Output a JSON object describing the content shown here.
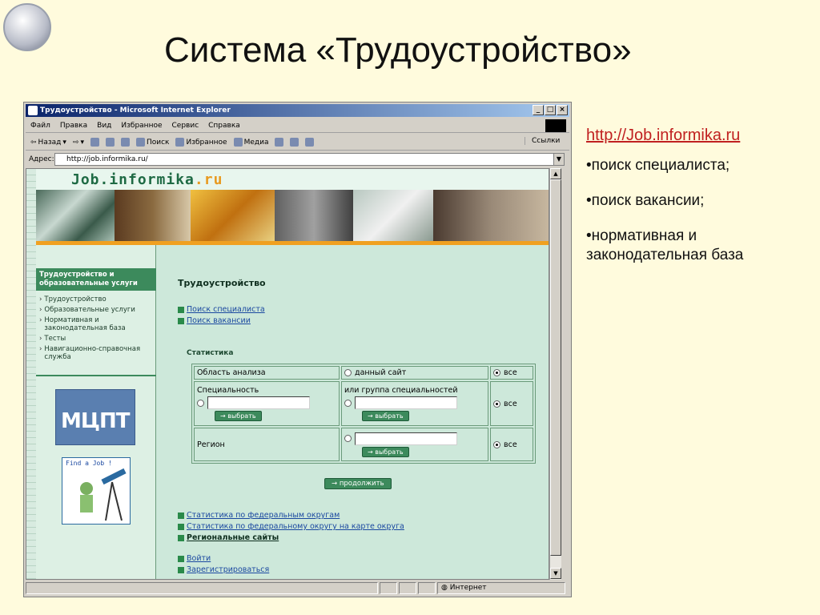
{
  "slide": {
    "title": "Система «Трудоустройство»",
    "url": "http://Job.informika.ru",
    "notes": [
      "•поиск специалиста;",
      "•поиск вакансии;",
      "•нормативная и законодательная база"
    ]
  },
  "browser": {
    "title": "Трудоустройство - Microsoft Internet Explorer",
    "menu": [
      "Файл",
      "Правка",
      "Вид",
      "Избранное",
      "Сервис",
      "Справка"
    ],
    "toolbar": {
      "back": "Назад",
      "search": "Поиск",
      "favorites": "Избранное",
      "media": "Медиа",
      "links": "Ссылки"
    },
    "address_label": "Адрес:",
    "address_value": "http://job.informika.ru/",
    "status_zone": "Интернет"
  },
  "site": {
    "title_main": "Job.informika",
    "title_tld": ".ru",
    "sidebar_heading": "Трудоустройство и образовательные услуги",
    "sidebar_items": [
      "Трудоустройство",
      "Образовательные услуги",
      "Нормативная и законодательная база",
      "Тесты",
      "Навигационно-справочная служба"
    ],
    "logo_text": "МЦПТ",
    "findjob_text": "Find a Job !",
    "main_heading": "Трудоустройство",
    "links_top": [
      "Поиск специалиста",
      "Поиск вакансии"
    ],
    "stats_heading": "Статистика",
    "table": {
      "row1_label": "Область анализа",
      "row1_option": "данный сайт",
      "all": "все",
      "row2_label": "Специальность",
      "row2_option": "или группа специальностей",
      "row3_label": "Регион",
      "select_btn": "→ выбрать"
    },
    "continue_btn": "→ продолжить",
    "links_bottom": [
      "Статистика по федеральным округам",
      "Статистика по федеральному округу на карте округа",
      "Региональные сайты"
    ],
    "links_auth": [
      "Войти",
      "Зарегистрироваться"
    ]
  }
}
